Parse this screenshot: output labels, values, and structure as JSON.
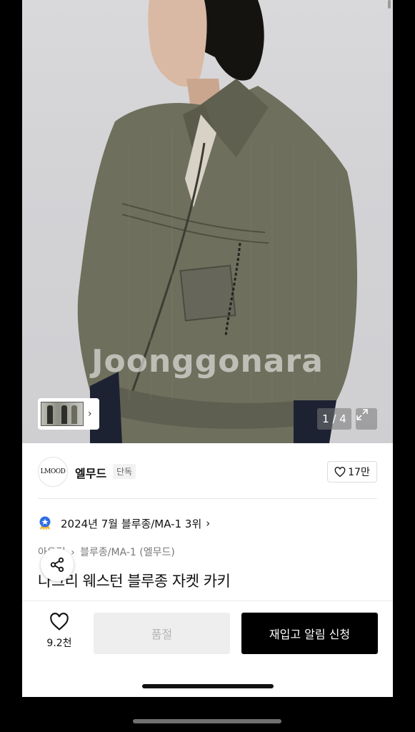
{
  "hero": {
    "watermark": "Joonggonara",
    "page_counter": "1 / 4"
  },
  "seller": {
    "logo_text": "LMOOD",
    "name": "엘무드",
    "tag": "단독",
    "likes": "17만"
  },
  "ranking": {
    "text": "2024년 7월 블루종/MA-1 3위"
  },
  "breadcrumb": {
    "first": "아우터",
    "second": "블루종/MA-1 (엘무드)"
  },
  "product": {
    "title": "나그리 웨스턴 블루종 자켓 카키"
  },
  "bottom_bar": {
    "wish_count": "9.2천",
    "soldout_label": "품절",
    "restock_label": "재입고 알림 신청"
  },
  "colors": {
    "primary_button": "#000000",
    "disabled_button": "#eeeeee",
    "rank_badge": "#2f6fe4"
  },
  "icons": [
    "heart-icon",
    "share-icon",
    "expand-icon",
    "chevron-right-icon",
    "rank-badge-icon"
  ]
}
